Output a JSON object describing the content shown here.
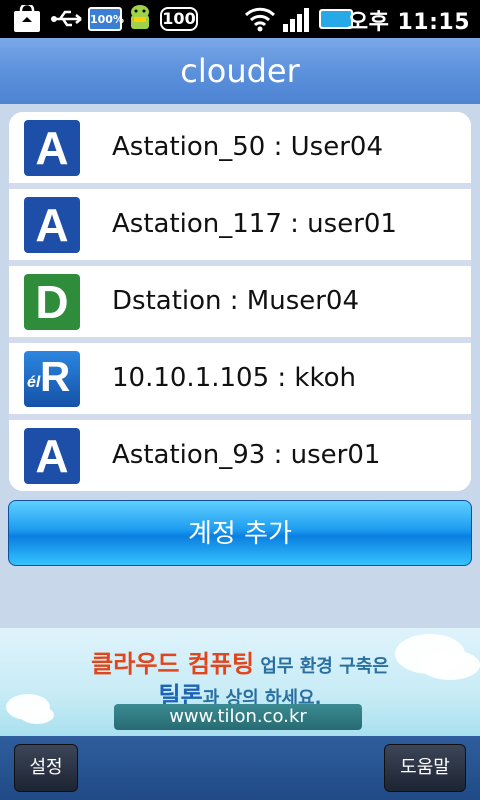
{
  "statusbar": {
    "battery_badge": "100%",
    "battery_level": "100",
    "time": "오후 11:15"
  },
  "app": {
    "title": "clouder"
  },
  "accounts": [
    {
      "icon_letter": "A",
      "icon_color": "#1e4fa8",
      "label": "Astation_50 : User04"
    },
    {
      "icon_letter": "A",
      "icon_color": "#1e4fa8",
      "label": "Astation_117 : user01"
    },
    {
      "icon_letter": "D",
      "icon_color": "#2e8c3a",
      "label": "Dstation : Muser04"
    },
    {
      "icon_letter": "R",
      "icon_sub": "él",
      "icon_color": "#1d6bc4",
      "label": "10.10.1.105 : kkoh"
    },
    {
      "icon_letter": "A",
      "icon_color": "#1e4fa8",
      "label": "Astation_93 : user01"
    }
  ],
  "add_button": {
    "label": "계정 추가"
  },
  "banner": {
    "highlight": "클라우드 컴퓨팅",
    "line1_rest": " 업무 환경 구축은",
    "brand": "틸론",
    "line2_rest": "과 상의 하세요.",
    "url": "www.tilon.co.kr"
  },
  "bottom": {
    "settings_label": "설정",
    "help_label": "도움말"
  }
}
